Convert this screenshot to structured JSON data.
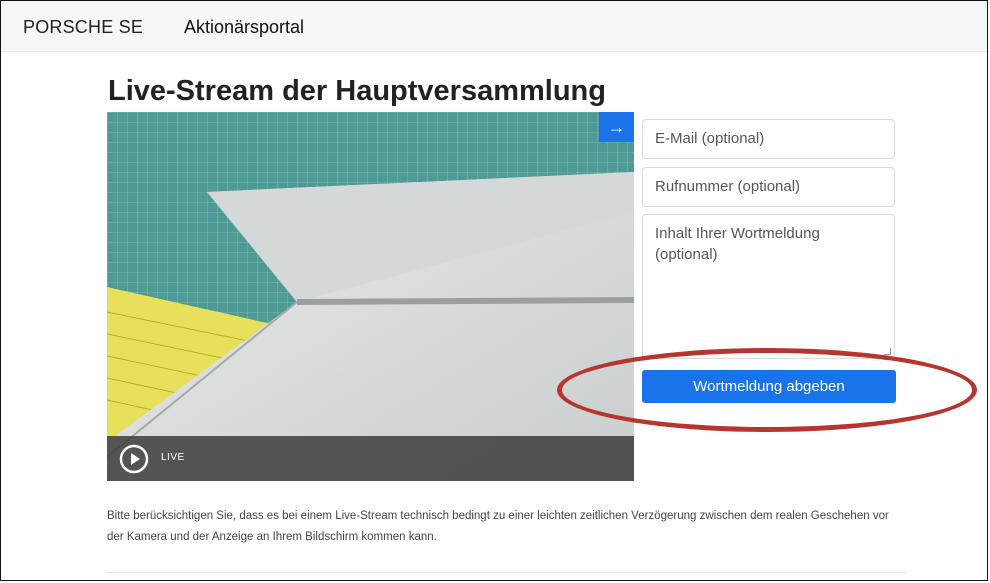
{
  "header": {
    "brand": "PORSCHE SE",
    "portal": "Aktionärsportal"
  },
  "page": {
    "title": "Live-Stream der Hauptversammlung"
  },
  "video": {
    "live_label": "LIVE",
    "icons": [
      "play-icon",
      "arrow-right-icon"
    ]
  },
  "form": {
    "email_placeholder": "E-Mail (optional)",
    "phone_placeholder": "Rufnummer (optional)",
    "message_placeholder": "Inhalt Ihrer Wortmeldung (optional)",
    "submit_label": "Wortmeldung abgeben"
  },
  "notice": {
    "text": "Bitte berücksichtigen Sie, dass es bei einem Live-Stream technisch bedingt zu einer leichten zeitlichen Verzögerung zwischen dem realen Geschehen vor der Kamera und der Anzeige an Ihrem Bildschirm kommen kann."
  },
  "colors": {
    "accent": "#1a73e8",
    "highlight": "#b5362f"
  }
}
